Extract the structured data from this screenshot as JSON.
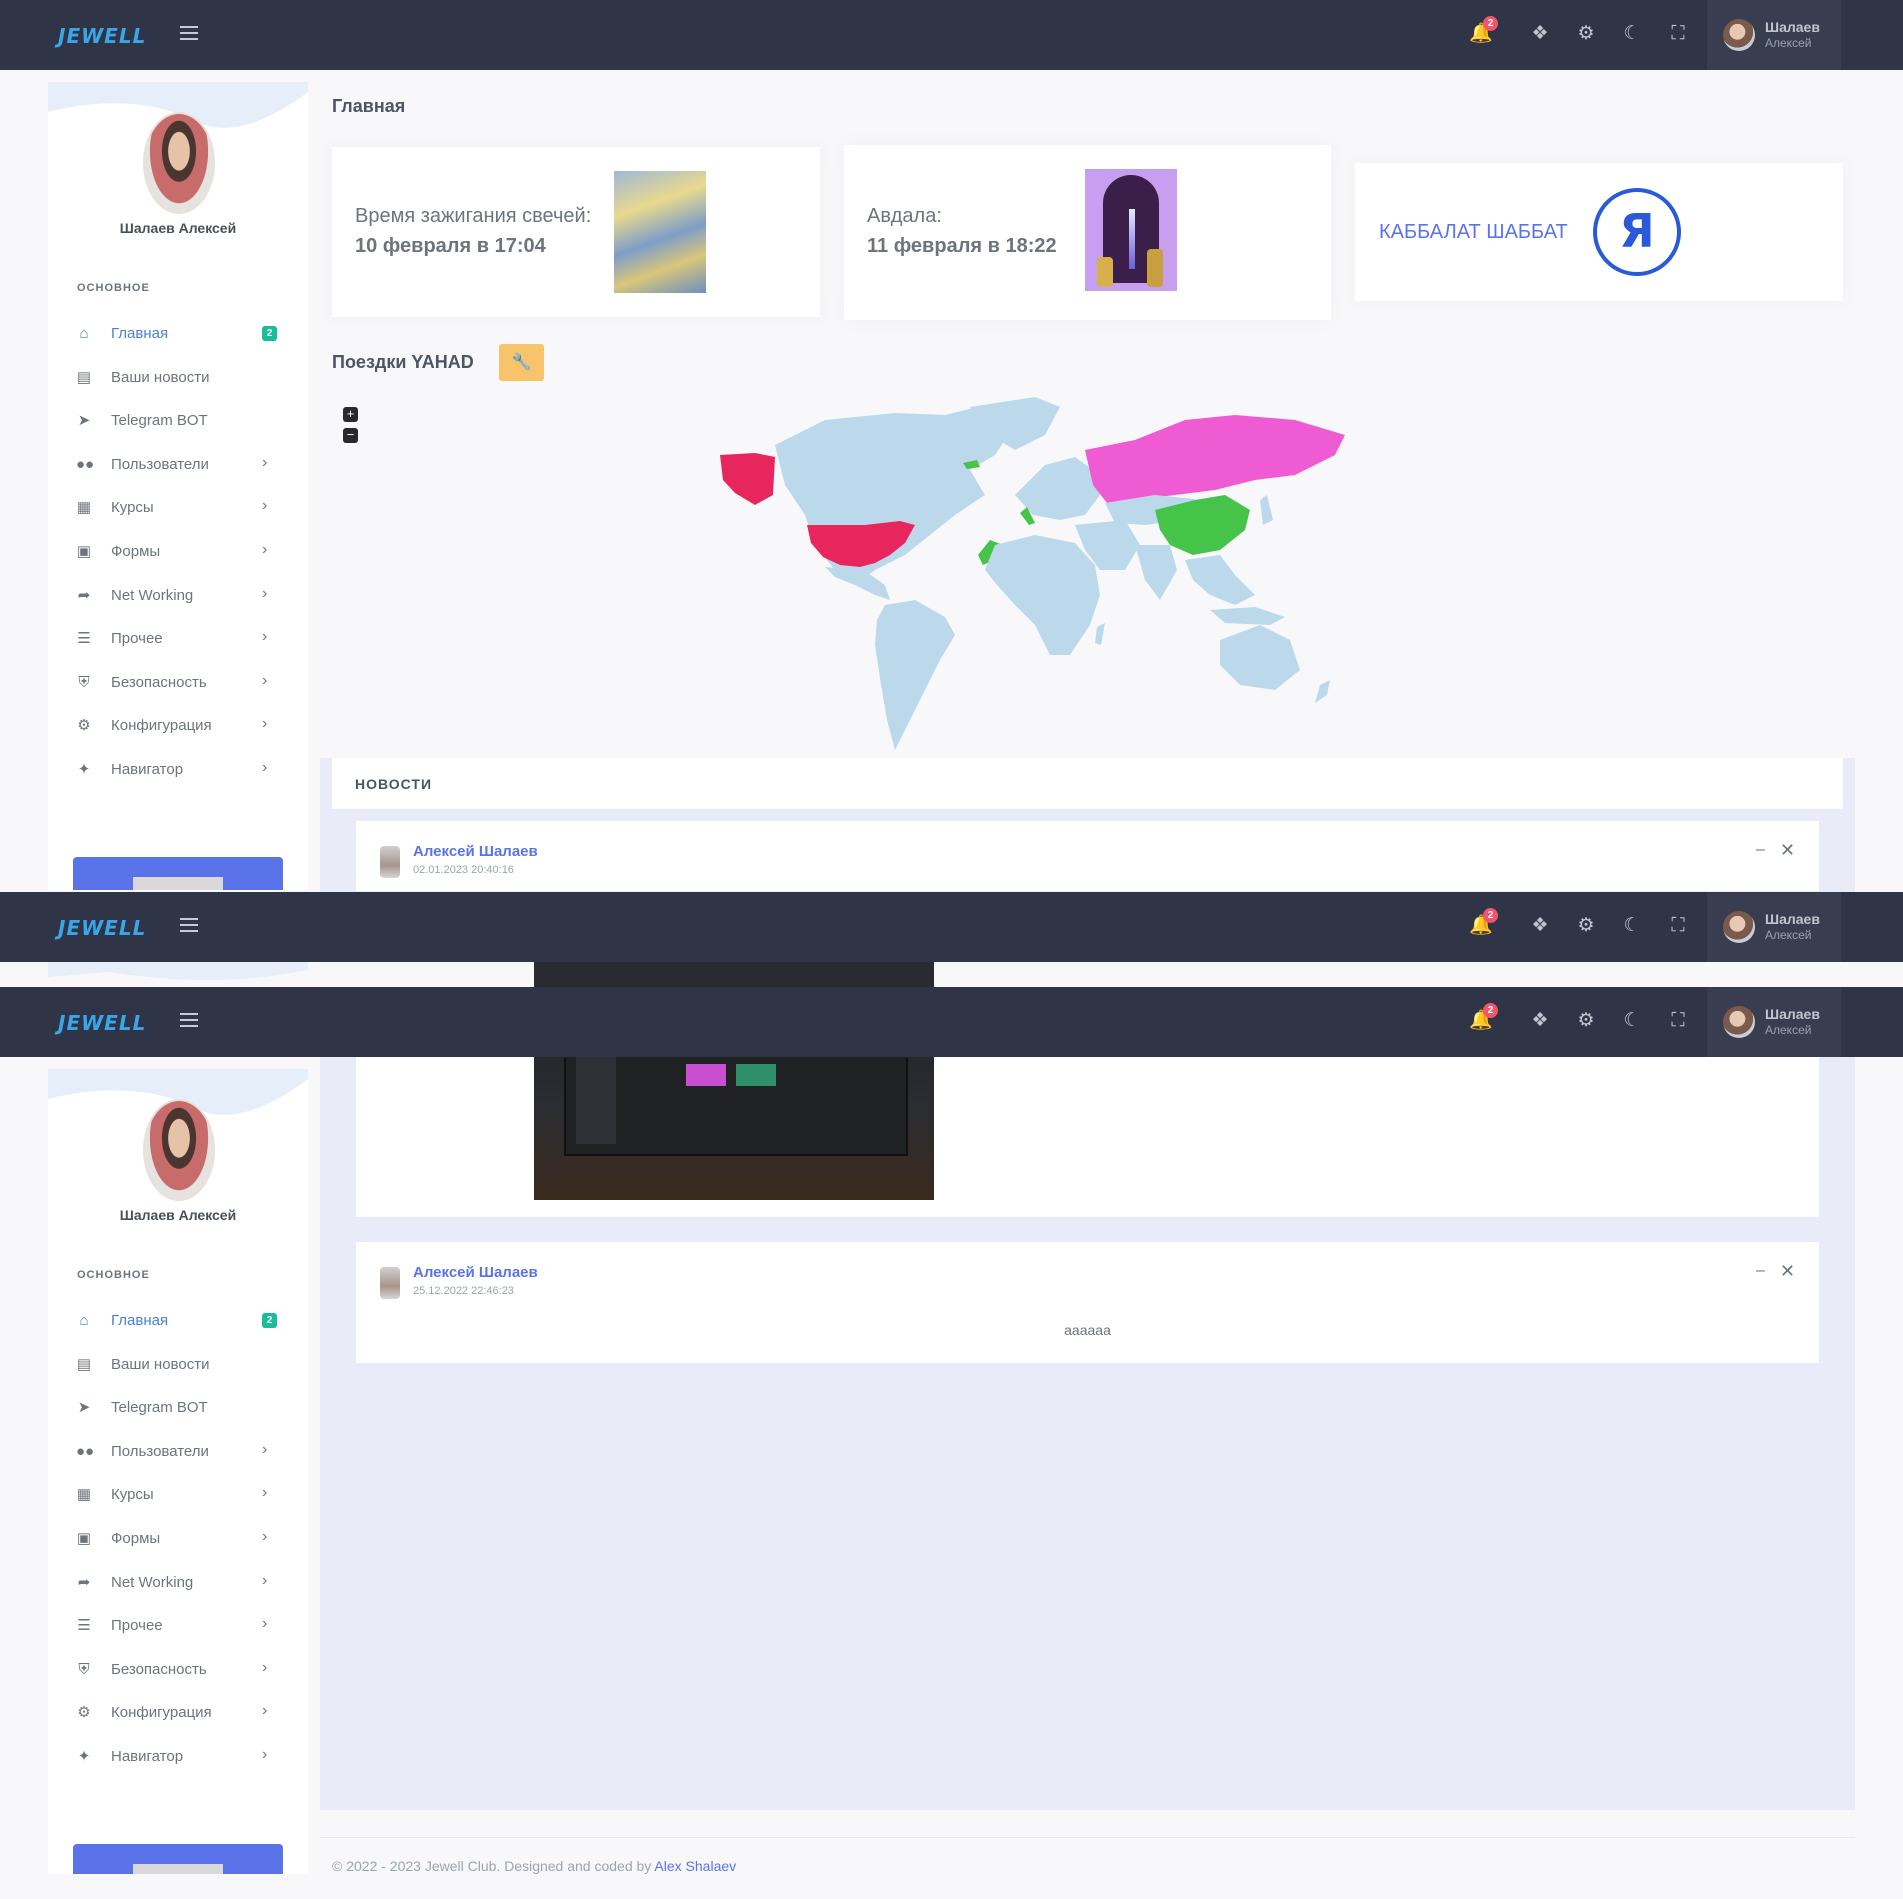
{
  "brand": {
    "logo_text": "JEWELL"
  },
  "topbar": {
    "notif_count": "2",
    "user_name": "Шалаев",
    "user_subname": "Алексей"
  },
  "sidebar": {
    "profile_name": "Шалаев Алексей",
    "section": "ОСНОВНОЕ",
    "items": [
      {
        "label": "Главная",
        "icon": "home-icon",
        "badge": "2",
        "active": true
      },
      {
        "label": "Ваши новости",
        "icon": "newspaper-icon"
      },
      {
        "label": "Telegram BOT",
        "icon": "telegram-icon"
      },
      {
        "label": "Пользователи",
        "icon": "users-icon",
        "chevron": true
      },
      {
        "label": "Курсы",
        "icon": "school-icon",
        "chevron": true
      },
      {
        "label": "Формы",
        "icon": "clipboard-icon",
        "chevron": true
      },
      {
        "label": "Net Working",
        "icon": "send-icon",
        "chevron": true
      },
      {
        "label": "Прочее",
        "icon": "list-icon",
        "chevron": true
      },
      {
        "label": "Безопасность",
        "icon": "shield-icon",
        "chevron": true
      },
      {
        "label": "Конфигурация",
        "icon": "gear-icon",
        "chevron": true
      },
      {
        "label": "Навигатор",
        "icon": "compass-icon",
        "chevron": true
      }
    ]
  },
  "main": {
    "page_title": "Главная",
    "candle_card": {
      "label": "Время зажигания свечей:",
      "value": "10 февраля в 17:04"
    },
    "havdala_card": {
      "label": "Авдала:",
      "value": "11 февраля в 18:22"
    },
    "kabbalat_card": {
      "label": "КАББАЛАТ ШАББАТ",
      "logo_letter": "Я"
    },
    "trips_title": "Поездки YAHAD",
    "zoom_in": "+",
    "zoom_out": "−",
    "map_colors": {
      "land": "#bcd9ec",
      "usa": "#e8265e",
      "russia": "#ef5bd3",
      "china": "#45c449"
    },
    "news_title": "НОВОСТИ",
    "posts": [
      {
        "author": "Алексей Шалаев",
        "date": "02.01.2023 20:40:16",
        "text": ""
      },
      {
        "author": "Алексей Шалаев",
        "date": "25.12.2022 22:46:23",
        "text": "aaaaaa"
      }
    ]
  },
  "footer": {
    "text": "© 2022 - 2023 Jewell Club. Designed and coded by ",
    "link": "Alex Shalaev"
  }
}
